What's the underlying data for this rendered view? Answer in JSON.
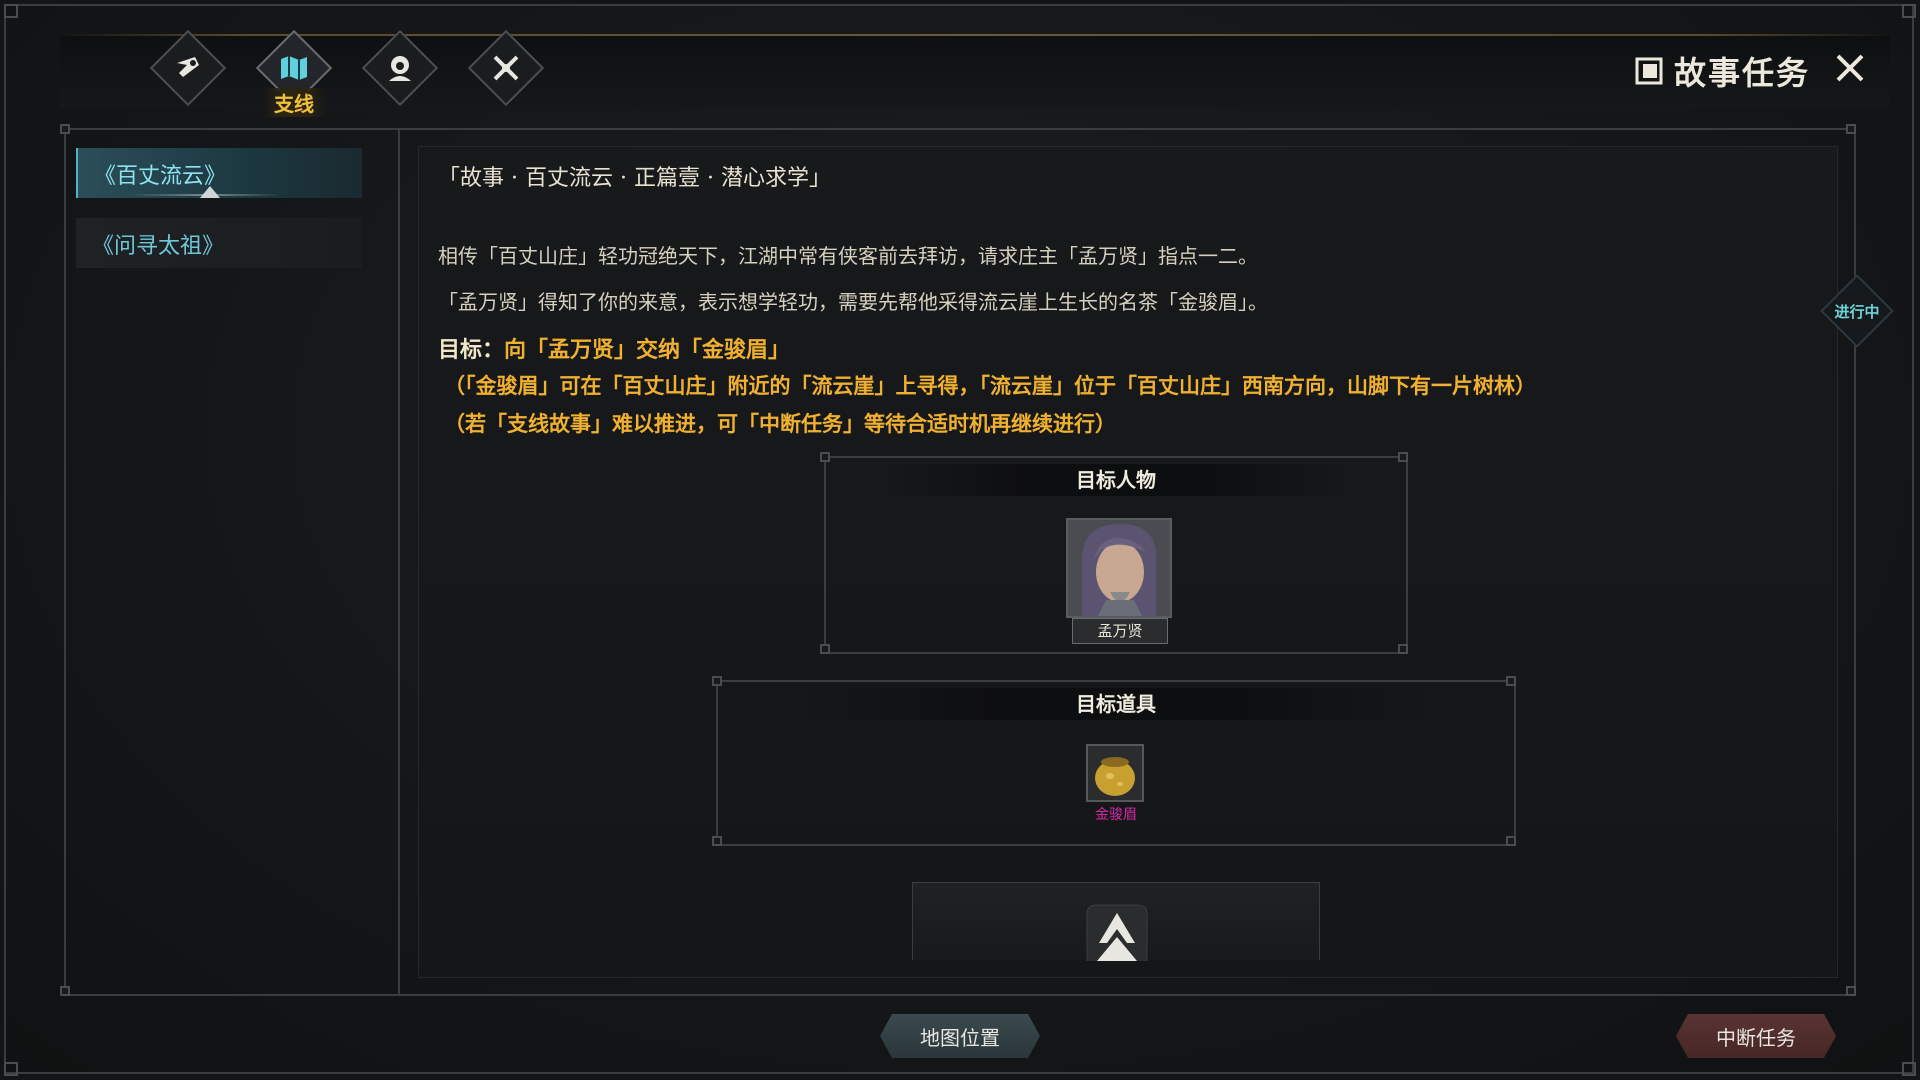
{
  "window": {
    "title": "故事任务",
    "title_icon": "book-icon",
    "close_icon": "close-icon"
  },
  "tabs": [
    {
      "icon": "scroll-seal-icon",
      "label": "",
      "active": false
    },
    {
      "icon": "open-map-icon",
      "label": "支线",
      "active": true
    },
    {
      "icon": "character-bust-icon",
      "label": "",
      "active": false
    },
    {
      "icon": "crossed-swords-icon",
      "label": "",
      "active": false
    }
  ],
  "sidebar": {
    "items": [
      {
        "label": "《百丈流云》",
        "active": true
      },
      {
        "label": "《问寻太祖》",
        "active": false
      }
    ]
  },
  "quest": {
    "title": "「故事 · 百丈流云 · 正篇壹 · 潜心求学」",
    "para1": "相传「百丈山庄」轻功冠绝天下，江湖中常有侠客前去拜访，请求庄主「孟万贤」指点一二。",
    "para2": "「孟万贤」得知了你的来意，表示想学轻功，需要先帮他采得流云崖上生长的名茶「金骏眉」。",
    "goal_lead": "目标：",
    "goal_text": "向「孟万贤」交纳「金骏眉」",
    "hint1": "（「金骏眉」可在「百丈山庄」附近的「流云崖」上寻得，「流云崖」位于「百丈山庄」西南方向，山脚下有一片树林）",
    "hint2": "（若「支线故事」难以推进，可「中断任务」等待合适时机再继续进行）",
    "status": "进行中"
  },
  "target_character": {
    "header": "目标人物",
    "name": "孟万贤"
  },
  "target_item": {
    "header": "目标道具",
    "name": "金骏眉",
    "name_color": "#d42aa8"
  },
  "buttons": {
    "map": "地图位置",
    "abort": "中断任务"
  },
  "colors": {
    "accent_gold": "#f0b030",
    "accent_cyan": "#6fc8d8",
    "tab_label": "#f0c040"
  }
}
